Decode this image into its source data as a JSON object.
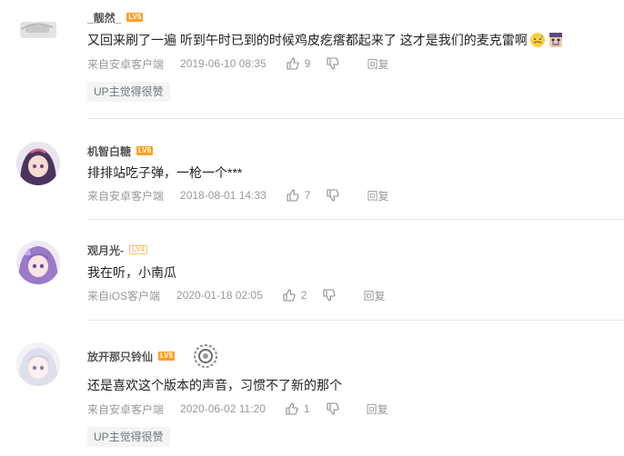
{
  "comments": [
    {
      "username": "_靓然_",
      "level": "LV5",
      "text": "又回来刷了一遍 听到午时已到的时候鸡皮疙瘩都起来了 这才是我们的麦克雷啊",
      "platform": "来自安卓客户端",
      "time": "2019-06-10 08:35",
      "likes": "9",
      "reply_label": "回复",
      "badge": "UP主觉得很赞",
      "emojis": [
        "sweat-face-emoji",
        "crying-character-emoji"
      ]
    },
    {
      "username": "机智白糖",
      "level": "LV5",
      "text": "排排站吃子弹，一枪一个***",
      "platform": "来自安卓客户端",
      "time": "2018-08-01 14:33",
      "likes": "7",
      "reply_label": "回复"
    },
    {
      "username": "观月光-",
      "level": "LV4",
      "text": "我在听，小南瓜",
      "platform": "来自iOS客户端",
      "time": "2020-01-18 02:05",
      "likes": "2",
      "reply_label": "回复"
    },
    {
      "username": "放开那只铃仙",
      "level": "LV5",
      "text": "还是喜欢这个版本的声音，习惯不了新的那个",
      "platform": "来自安卓客户端",
      "time": "2020-06-02 11:20",
      "likes": "1",
      "reply_label": "回复",
      "badge": "UP主觉得很赞"
    }
  ],
  "colors": {
    "level_badge": "#ff9f20",
    "divider": "#e5e9ef",
    "meta_text": "#999999"
  }
}
